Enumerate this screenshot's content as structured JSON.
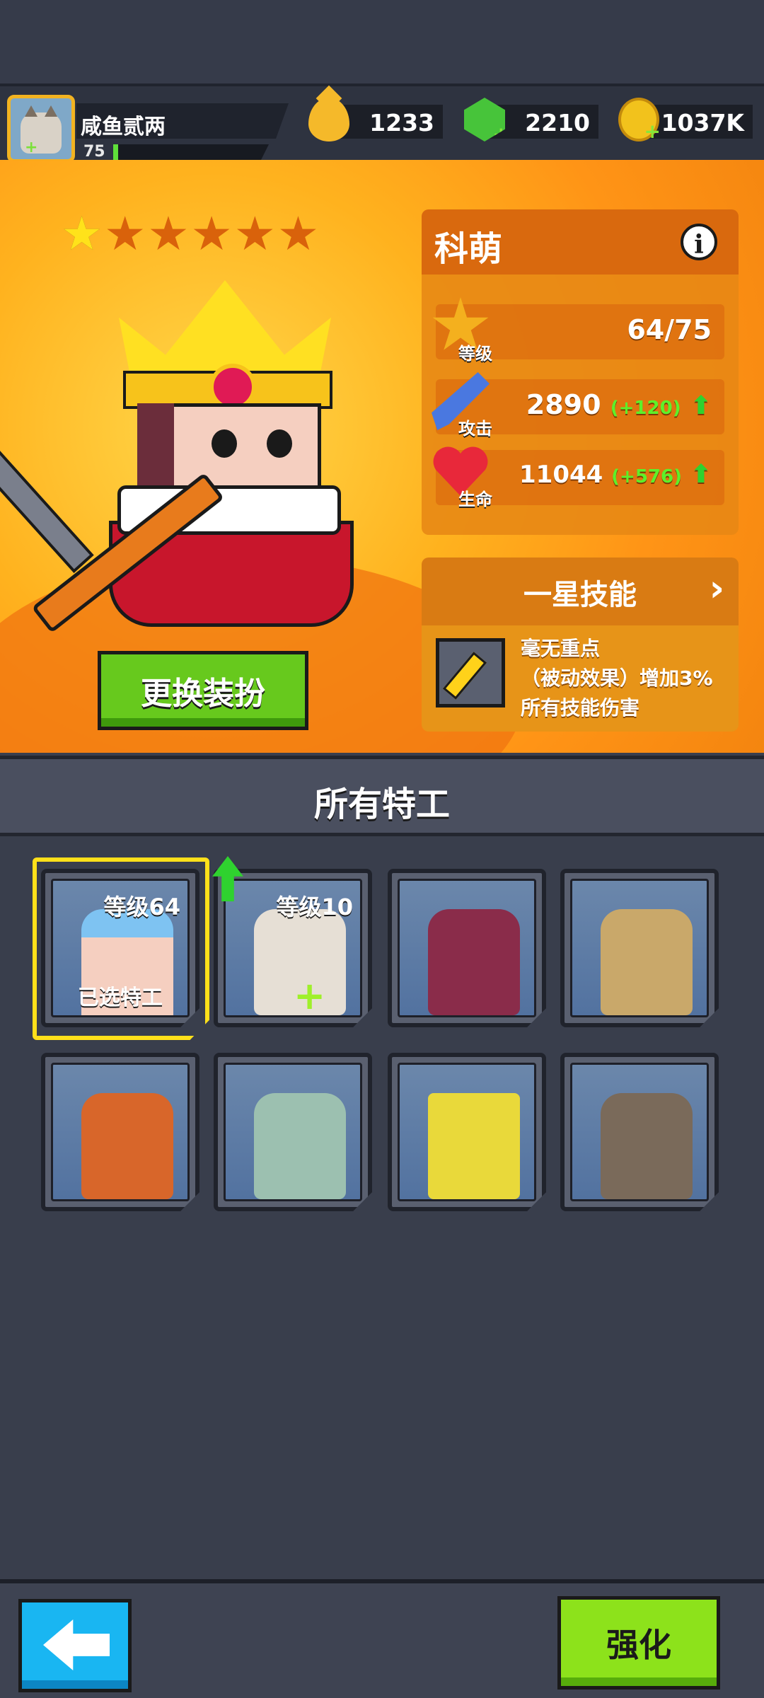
{
  "player": {
    "name": "咸鱼贰两",
    "level": "75",
    "xp_progress": 0.03
  },
  "resources": [
    {
      "icon": "oil-drop-icon",
      "value": "1233"
    },
    {
      "icon": "green-gem-icon",
      "value": "2210"
    },
    {
      "icon": "gold-coin-icon",
      "value": "1037K"
    }
  ],
  "hero": {
    "stars_filled": 1,
    "stars_total": 6,
    "name": "科萌",
    "change_outfit_label": "更换装扮",
    "stats": {
      "level": {
        "label": "等级",
        "value": "64/75"
      },
      "attack": {
        "label": "攻击",
        "value": "2890",
        "bonus": "(+120)"
      },
      "hp": {
        "label": "生命",
        "value": "11044",
        "bonus": "(+576)"
      }
    },
    "skill": {
      "title": "一星技能",
      "line1": "毫无重点",
      "line2": "（被动效果）增加3%",
      "line3": "所有技能伤害"
    }
  },
  "agents_section": {
    "title": "所有特工",
    "cards": [
      {
        "level_text": "等级64",
        "tag": "已选特工",
        "selected": true,
        "portrait": "red-scarf-goggles-agent"
      },
      {
        "level_text": "等级10",
        "upgrade_available": true,
        "portrait": "cat-agent"
      },
      {
        "portrait": "pink-hair-agent"
      },
      {
        "portrait": "masked-agent"
      },
      {
        "portrait": "red-hair-agent"
      },
      {
        "portrait": "squidward-agent"
      },
      {
        "portrait": "spongebob-agent"
      },
      {
        "portrait": "eyepatch-agent"
      }
    ]
  },
  "bottom": {
    "strengthen_label": "强化"
  },
  "colors": {
    "accent_orange": "#ff9416",
    "button_green": "#67c91d",
    "back_blue": "#19b6f2",
    "highlight_yellow": "#ffe01a"
  }
}
